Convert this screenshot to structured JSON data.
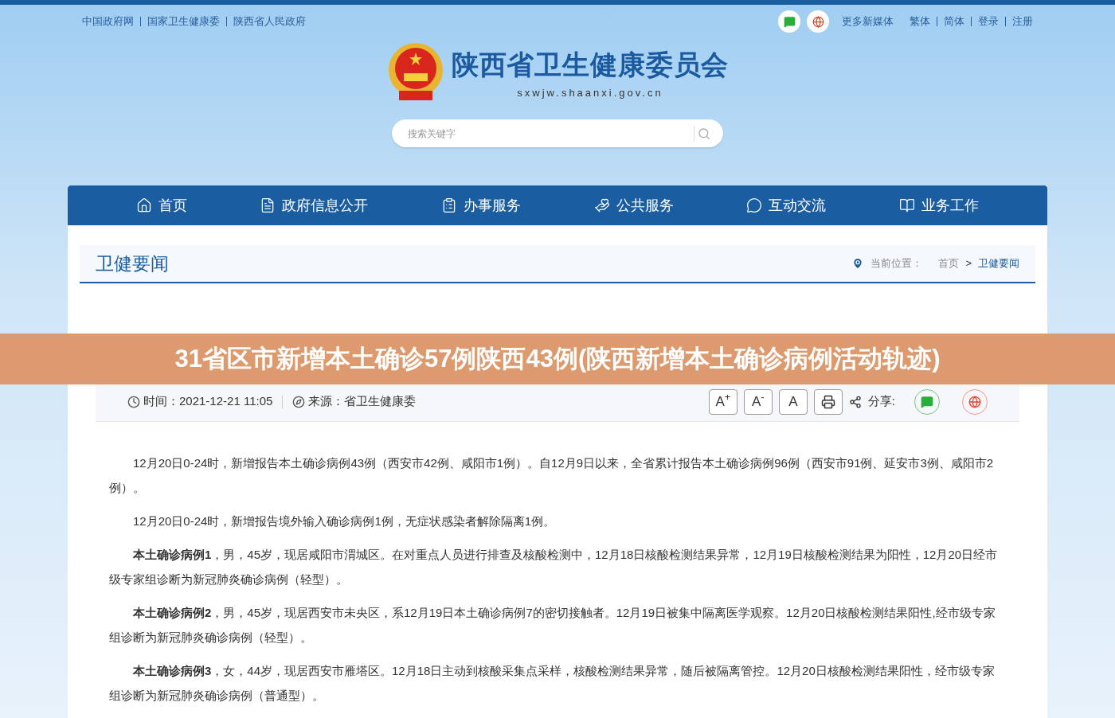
{
  "top_links": [
    "中国政府网",
    "国家卫生健康委",
    "陕西省人民政府"
  ],
  "top_right": {
    "media_label": "更多新媒体",
    "links": [
      "繁体",
      "简体",
      "登录",
      "注册"
    ]
  },
  "site": {
    "name": "陕西省卫生健康委员会",
    "domain": "sxwjw.shaanxi.gov.cn"
  },
  "search": {
    "placeholder": "搜索关键字"
  },
  "nav": [
    {
      "label": "首页"
    },
    {
      "label": "政府信息公开"
    },
    {
      "label": "办事服务"
    },
    {
      "label": "公共服务"
    },
    {
      "label": "互动交流"
    },
    {
      "label": "业务工作"
    }
  ],
  "section": {
    "title": "卫健要闻",
    "location_label": "当前位置：",
    "crumbs": [
      "首页",
      "卫健要闻"
    ],
    "separator": ">"
  },
  "banner": "31省区市新增本土确诊57例陕西43例(陕西新增本土确诊病例活动轨迹)",
  "meta": {
    "time": "时间：2021-12-21 11:05",
    "source": "来源：省卫生健康委",
    "font_buttons": [
      "A$^{+}$",
      "A$^{-}$",
      "A"
    ],
    "share_label": "分享:"
  },
  "paragraphs": [
    "12月20日0-24时，新增报告本土确诊病例43例（西安市42例、咸阳市1例）。自12月9日以来，全省累计报告本土确诊病例96例（西安市91例、延安市3例、咸阳市2例）。",
    "12月20日0-24时，新增报告境外输入确诊病例1例，无症状感染者解除隔离1例。",
    "**本土确诊病例1**，男，45岁，现居咸阳市渭城区。在对重点人员进行排查及核酸检测中，12月18日核酸检测结果异常，12月19日核酸检测结果为阳性，12月20日经市级专家组诊断为新冠肺炎确诊病例（轻型）。",
    "**本土确诊病例2**，男，45岁，现居西安市未央区，系12月19日本土确诊病例7的密切接触者。12月19日被集中隔离医学观察。12月20日核酸检测结果阳性,经市级专家组诊断为新冠肺炎确诊病例（轻型）。",
    "**本土确诊病例3**，女，44岁，现居西安市雁塔区。12月18日主动到核酸采集点采样，核酸检测结果异常，随后被隔离管控。12月20日核酸检测结果阳性，经市级专家组诊断为新冠肺炎确诊病例（普通型）。"
  ]
}
